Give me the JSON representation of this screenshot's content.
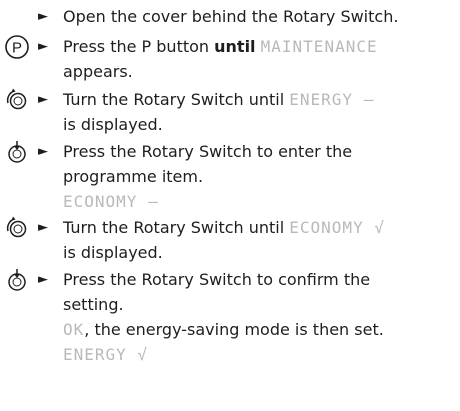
{
  "steps": [
    {
      "icon": "",
      "text": "Open the cover behind the Rotary Switch."
    },
    {
      "icon": "P",
      "text_before": "Press the P button ",
      "bold": "until",
      "text_after": " ",
      "lcd": "MAINTENANCE",
      "cont": "appears."
    },
    {
      "icon": "",
      "text_before": "Turn the Rotary Switch until ",
      "lcd": "ENERGY –",
      "cont": "is displayed."
    },
    {
      "icon": "",
      "text": "Press the Rotary Switch to enter the",
      "cont": "programme item.",
      "lcd_line": "ECONOMY –"
    },
    {
      "icon": "",
      "text_before": "Turn the Rotary Switch until ",
      "lcd": "ECONOMY √",
      "cont": "is displayed."
    },
    {
      "icon": "",
      "text": "Press the Rotary Switch to confirm the",
      "cont": "setting.",
      "lcd_prefix": "OK",
      "cont2": ", the energy-saving mode is then set.",
      "lcd_line": "ENERGY √"
    }
  ],
  "arrow_glyph": "►"
}
